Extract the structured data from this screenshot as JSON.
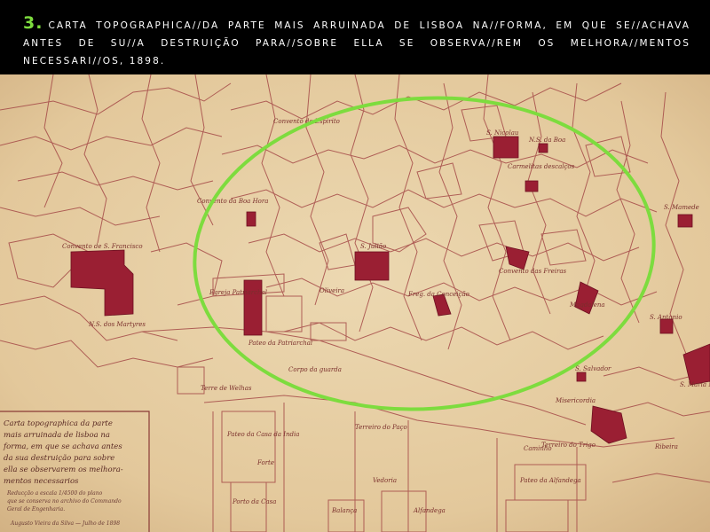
{
  "caption": {
    "number": "3.",
    "text": "carta topographica//da parte mais arruinada de lisboa na//forma, em que se//achava antes de su//a destruição para//sobre ella se observa//rem os melhora//mentos necessari//os, 1898."
  },
  "colors": {
    "paper": "#e6cfa5",
    "ink_lines": "#a54a48",
    "blocks": "#9a1f33",
    "highlight_circle": "#7ddc3e",
    "header_bg": "#000000"
  },
  "map_labels": {
    "convento_sfrancisco": "Convento de S. Francisco",
    "ns_martyres": "N.S. dos Martyres",
    "convento_boa_hora": "Convento da Boa Hora",
    "convento_espirito": "Convento do Espirito",
    "egreja_patriarchal": "Egreja Patriarchal",
    "pateo_patriarchal": "Pateo da Patriarchal",
    "corpo_guarda": "Corpo da guarda",
    "s_julião": "S. Julião",
    "oliveira": "Oliveira",
    "freg_conceição": "Freg. da Conceição",
    "s_nicolau": "S. Nicolau",
    "ns_da_boa": "N.S. da Boa",
    "carmelitas_descalços": "Carmelitas descalços",
    "convento_pedreiros": "Convento das Freiras",
    "magdalena": "Magdalena",
    "s_antonio": "S. Antonio",
    "s_mamede": "S. Mamede",
    "s_maria_maior": "S. Maria Maior",
    "misericordia": "Misericordia",
    "s_salvador": "S. Salvador",
    "terreiro_trigo": "Terreiro do Trigo",
    "ribeira": "Ribeira",
    "terreiro_paço": "Terreiro do Paço",
    "forte": "Forte",
    "pateo_casa_india": "Pateo da Casa da India",
    "alfandega": "Alfandega",
    "pateo_alfandega": "Pateo da Alfandega",
    "vedoria": "Vedoria",
    "balança": "Balança",
    "porto": "Porto da Casa",
    "terreiro_welhas": "Terre de Welhas",
    "caminho": "Caminho",
    "mar_da_ribeira": "Ribeira"
  },
  "legend_box": {
    "lines": [
      "Carta topographica da parte",
      "mais arruinada de lisboa na",
      "forma, em que se achava antes",
      "da sua destruição para sobre",
      "ella se observarem os melhora-",
      "mentos necessarios"
    ],
    "note1": "Reducção a escala 1/4500 do plano",
    "note2": "que se conserva no archivo do Commando",
    "note3": "Geral de Engenharia.",
    "signature": "Augusto Vieira da Silva — Julho de 1898"
  }
}
